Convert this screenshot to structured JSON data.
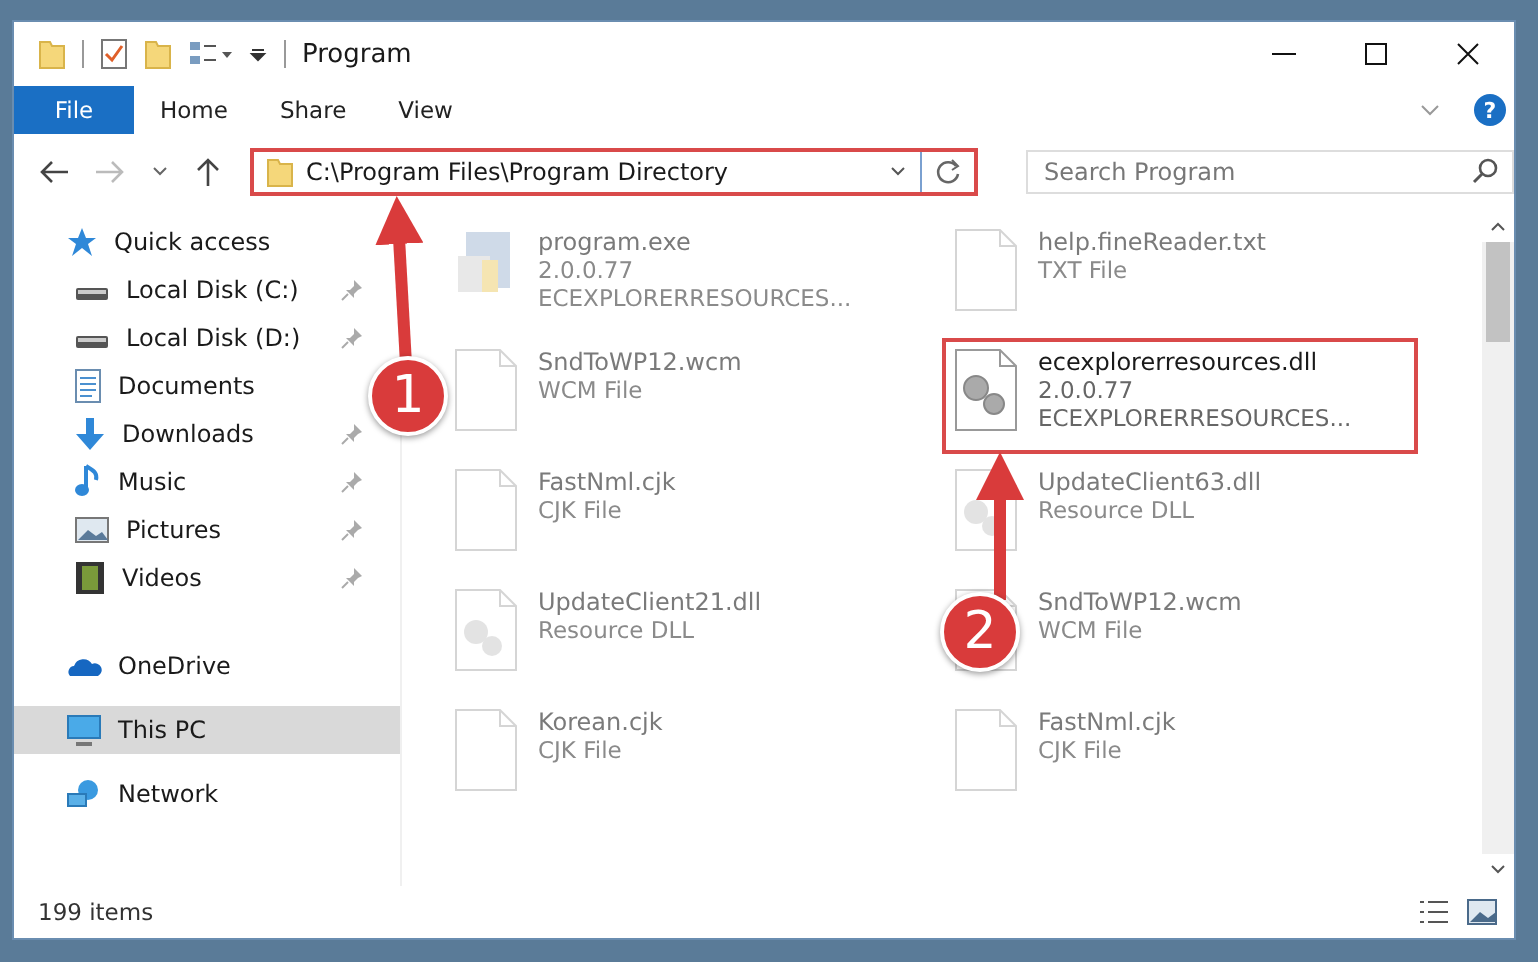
{
  "window": {
    "title": "Program"
  },
  "ribbon": {
    "tabs": [
      {
        "label": "File",
        "selected": true
      },
      {
        "label": "Home",
        "selected": false
      },
      {
        "label": "Share",
        "selected": false
      },
      {
        "label": "View",
        "selected": false
      }
    ],
    "help": "?"
  },
  "address": {
    "path": "C:\\Program Files\\Program Directory",
    "highlighted": true
  },
  "search": {
    "placeholder": "Search Program"
  },
  "nav": [
    {
      "label": "Quick access",
      "kind": "quick",
      "selected": false,
      "children": [
        {
          "label": "Local Disk (C:)",
          "kind": "drive",
          "selected": false,
          "pinned": true
        },
        {
          "label": "Local Disk (D:)",
          "kind": "drive",
          "selected": false,
          "pinned": true
        },
        {
          "label": "Documents",
          "kind": "documents",
          "selected": false,
          "pinned": false
        },
        {
          "label": "Downloads",
          "kind": "downloads",
          "selected": false,
          "pinned": true
        },
        {
          "label": "Music",
          "kind": "music",
          "selected": false,
          "pinned": true
        },
        {
          "label": "Pictures",
          "kind": "pictures",
          "selected": false,
          "pinned": true
        },
        {
          "label": "Videos",
          "kind": "videos",
          "selected": false,
          "pinned": true
        }
      ]
    },
    {
      "label": "OneDrive",
      "kind": "onedrive",
      "selected": false
    },
    {
      "label": "This PC",
      "kind": "pc",
      "selected": true
    },
    {
      "label": "Network",
      "kind": "network",
      "selected": false
    }
  ],
  "files": [
    {
      "name": "program.exe",
      "details": [
        "2.0.0.77",
        "ECEXPLORERRESOURCES..."
      ],
      "kind": "exe",
      "dimmed": true,
      "highlighted": false
    },
    {
      "name": "help.fineReader.txt",
      "details": [
        "TXT File"
      ],
      "kind": "blank",
      "dimmed": true,
      "highlighted": false
    },
    {
      "name": "SndToWP12.wcm",
      "details": [
        "WCM File"
      ],
      "kind": "blank",
      "dimmed": true,
      "highlighted": false
    },
    {
      "name": "ecexplorerresources.dll",
      "details": [
        "2.0.0.77",
        "ECEXPLORERRESOURCES..."
      ],
      "kind": "gear",
      "dimmed": false,
      "highlighted": true
    },
    {
      "name": "FastNml.cjk",
      "details": [
        "CJK File"
      ],
      "kind": "blank",
      "dimmed": true,
      "highlighted": false
    },
    {
      "name": "UpdateClient63.dll",
      "details": [
        "Resource DLL"
      ],
      "kind": "dll",
      "dimmed": true,
      "highlighted": false
    },
    {
      "name": "UpdateClient21.dll",
      "details": [
        "Resource DLL"
      ],
      "kind": "dll",
      "dimmed": true,
      "highlighted": false
    },
    {
      "name": "SndToWP12.wcm",
      "details": [
        "WCM File"
      ],
      "kind": "blank",
      "dimmed": true,
      "highlighted": false
    },
    {
      "name": "Korean.cjk",
      "details": [
        "CJK File"
      ],
      "kind": "blank",
      "dimmed": true,
      "highlighted": false
    },
    {
      "name": "FastNml.cjk",
      "details": [
        "CJK File"
      ],
      "kind": "blank",
      "dimmed": true,
      "highlighted": false
    }
  ],
  "annotations": [
    {
      "number": "1"
    },
    {
      "number": "2"
    }
  ],
  "status_bar": {
    "count": "199 items"
  }
}
